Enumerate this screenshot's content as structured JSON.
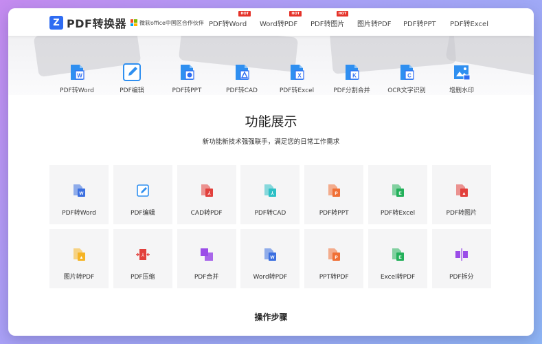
{
  "header": {
    "logo_letter": "Z",
    "logo_text": "PDF转换器",
    "partner_text": "微软office中国区合作伙伴",
    "hot_badge": "HOT",
    "nav": [
      {
        "label": "PDF转Word",
        "hot": true
      },
      {
        "label": "Word转PDF",
        "hot": true
      },
      {
        "label": "PDF转图片",
        "hot": true
      },
      {
        "label": "图片转PDF",
        "hot": false
      },
      {
        "label": "PDF转PPT",
        "hot": false
      },
      {
        "label": "PDF转Excel",
        "hot": false
      }
    ]
  },
  "toolbar": [
    {
      "label": "PDF转Word",
      "icon": "pdf-to-word-icon",
      "glyph": "W"
    },
    {
      "label": "PDF编辑",
      "icon": "pdf-edit-icon",
      "glyph": "✎"
    },
    {
      "label": "PDF转PPT",
      "icon": "pdf-to-ppt-icon",
      "glyph": "◔"
    },
    {
      "label": "PDF转CAD",
      "icon": "pdf-to-cad-icon",
      "glyph": "⅄"
    },
    {
      "label": "PDF转Excel",
      "icon": "pdf-to-excel-icon",
      "glyph": "X"
    },
    {
      "label": "PDF分割合并",
      "icon": "pdf-split-merge-icon",
      "glyph": "K"
    },
    {
      "label": "OCR文字识别",
      "icon": "ocr-icon",
      "glyph": "C"
    },
    {
      "label": "增删水印",
      "icon": "watermark-icon",
      "glyph": "▲"
    }
  ],
  "features": {
    "title": "功能展示",
    "subtitle": "新功能新技术强强联手，满足您的日常工作需求",
    "cards": [
      {
        "label": "PDF转Word",
        "icon": "pdf-to-word-icon",
        "color": "#3b6fe0",
        "glyph": "W"
      },
      {
        "label": "PDF编辑",
        "icon": "pdf-edit-icon",
        "color": "#2f8ff0",
        "glyph": "✎"
      },
      {
        "label": "CAD转PDF",
        "icon": "cad-to-pdf-icon",
        "color": "#e2403c",
        "glyph": "⅄"
      },
      {
        "label": "PDF转CAD",
        "icon": "pdf-to-cad-icon",
        "color": "#2cc0c6",
        "glyph": "⅄"
      },
      {
        "label": "PDF转PPT",
        "icon": "pdf-to-ppt-icon",
        "color": "#f07036",
        "glyph": "P"
      },
      {
        "label": "PDF转Excel",
        "icon": "pdf-to-excel-icon",
        "color": "#23b05a",
        "glyph": "E"
      },
      {
        "label": "PDF转图片",
        "icon": "pdf-to-image-icon",
        "color": "#e2403c",
        "glyph": "▲"
      },
      {
        "label": "图片转PDF",
        "icon": "image-to-pdf-icon",
        "color": "#f5b425",
        "glyph": "▲"
      },
      {
        "label": "PDF压缩",
        "icon": "pdf-compress-icon",
        "color": "#e2403c",
        "glyph": "⅄"
      },
      {
        "label": "PDF合并",
        "icon": "pdf-merge-icon",
        "color": "#9b4de8",
        "glyph": ""
      },
      {
        "label": "Word转PDF",
        "icon": "word-to-pdf-icon",
        "color": "#3b6fe0",
        "glyph": "W"
      },
      {
        "label": "PPT转PDF",
        "icon": "ppt-to-pdf-icon",
        "color": "#f07036",
        "glyph": "P"
      },
      {
        "label": "Excel转PDF",
        "icon": "excel-to-pdf-icon",
        "color": "#23b05a",
        "glyph": "E"
      },
      {
        "label": "PDF拆分",
        "icon": "pdf-split-icon",
        "color": "#9b4de8",
        "glyph": ""
      }
    ]
  },
  "steps": {
    "title": "操作步骤"
  },
  "colors": {
    "brand": "#2f6cf2",
    "hot": "#e5332a",
    "card_bg": "#f5f5f6"
  }
}
